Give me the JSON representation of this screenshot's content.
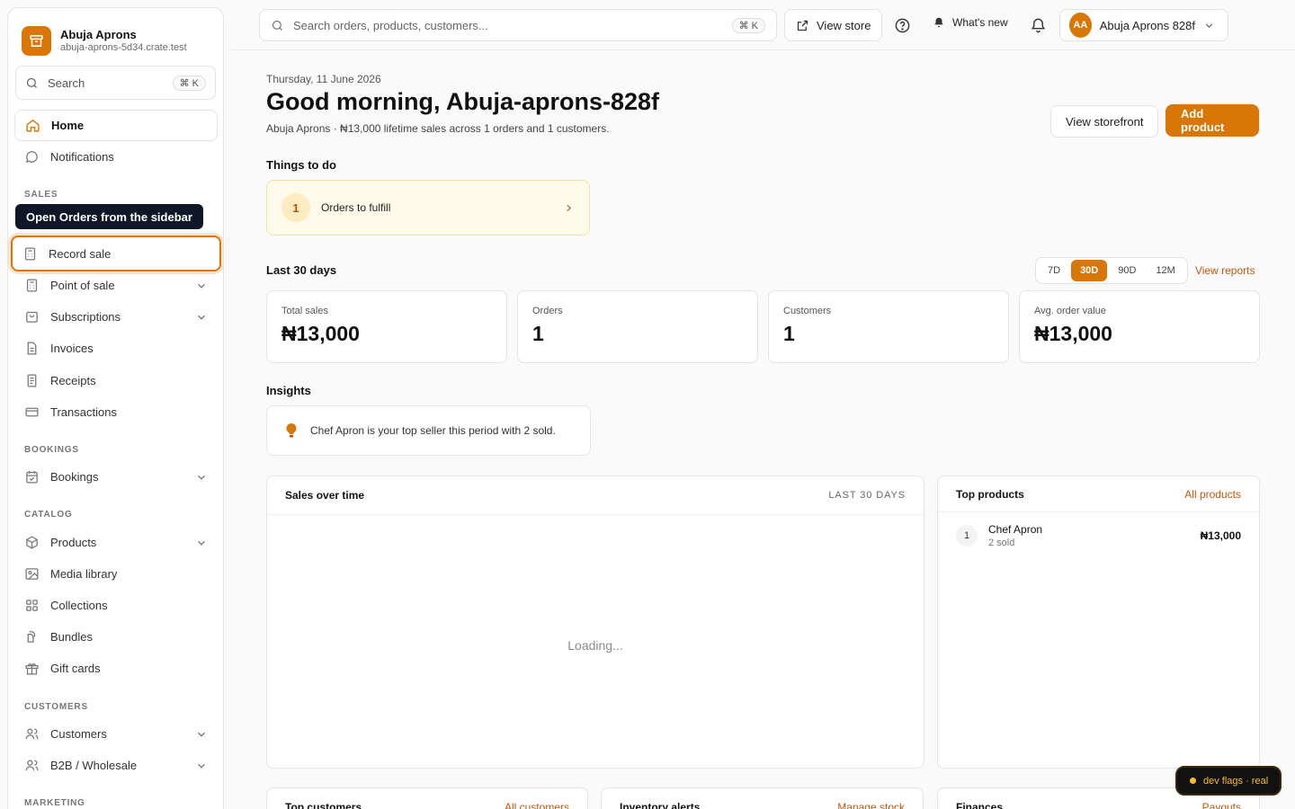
{
  "brand": {
    "name": "Abuja Aprons",
    "domain": "abuja-aprons-5d34.crate.test"
  },
  "sidebar": {
    "search": {
      "label": "Search",
      "shortcut": "⌘ K"
    },
    "home": "Home",
    "notifications": "Notifications",
    "tooltip": "Open Orders from the sidebar",
    "sections": {
      "sales": "SALES",
      "bookings": "BOOKINGS",
      "catalog": "CATALOG",
      "customers": "CUSTOMERS",
      "marketing": "MARKETING"
    },
    "items": {
      "record_sale": "Record sale",
      "point_of_sale": "Point of sale",
      "subscriptions": "Subscriptions",
      "invoices": "Invoices",
      "receipts": "Receipts",
      "transactions": "Transactions",
      "bookings": "Bookings",
      "products": "Products",
      "media_library": "Media library",
      "collections": "Collections",
      "bundles": "Bundles",
      "gift_cards": "Gift cards",
      "customers": "Customers",
      "b2b": "B2B / Wholesale"
    }
  },
  "topbar": {
    "search_placeholder": "Search orders, products, customers...",
    "search_shortcut": "⌘ K",
    "view_store": "View store",
    "whats_new": "What's new",
    "account_initials": "AA",
    "account_name": "Abuja Aprons 828f"
  },
  "main": {
    "date": "Thursday, 11 June 2026",
    "greeting": "Good morning, Abuja-aprons-828f",
    "subline": "Abuja Aprons · ₦13,000 lifetime sales across 1 orders and 1 customers.",
    "view_storefront": "View storefront",
    "add_product": "Add product",
    "todo_heading": "Things to do",
    "todo": {
      "count": "1",
      "label": "Orders to fulfill"
    },
    "period_heading": "Last 30 days",
    "ranges": [
      "7D",
      "30D",
      "90D",
      "12M"
    ],
    "view_reports": "View reports",
    "stats": [
      {
        "label": "Total sales",
        "value": "₦13,000"
      },
      {
        "label": "Orders",
        "value": "1"
      },
      {
        "label": "Customers",
        "value": "1"
      },
      {
        "label": "Avg. order value",
        "value": "₦13,000"
      }
    ],
    "insights_heading": "Insights",
    "insight": "Chef Apron is your top seller this period with 2 sold.",
    "sales_card": {
      "title": "Sales over time",
      "meta": "LAST 30 DAYS",
      "loading": "Loading..."
    },
    "top_products": {
      "title": "Top products",
      "link": "All products",
      "items": [
        {
          "rank": "1",
          "name": "Chef Apron",
          "sold": "2 sold",
          "amount": "₦13,000"
        }
      ]
    },
    "bottom_cards": [
      {
        "title": "Top customers",
        "link": "All customers"
      },
      {
        "title": "Inventory alerts",
        "link": "Manage stock"
      },
      {
        "title": "Finances",
        "link": "Payouts"
      }
    ]
  },
  "devflags": "dev flags · real",
  "colors": {
    "accent": "#d97706",
    "tooltip_bg": "#0f1729",
    "link": "#c2570a"
  }
}
